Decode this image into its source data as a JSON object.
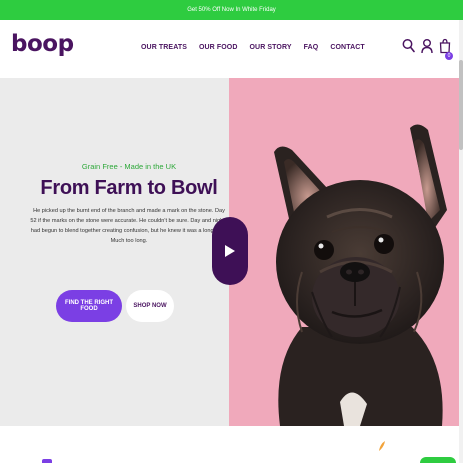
{
  "promo": {
    "text": "Get 50% Off Now In White Friday"
  },
  "brand": {
    "logo": "boop",
    "color": "#4a1460"
  },
  "nav": {
    "items": [
      "OUR TREATS",
      "OUR FOOD",
      "OUR STORY",
      "FAQ",
      "CONTACT"
    ]
  },
  "header_icons": [
    "search-icon",
    "account-icon",
    "cart-icon"
  ],
  "cart": {
    "count": "0"
  },
  "hero": {
    "eyebrow": "Grain Free - Made in the UK",
    "title": "From Farm to Bowl",
    "body": "He picked up the burnt end of the branch and made a mark on the stone. Day 52 if the marks on the stone were accurate. He couldn't be sure. Day and nights had begun to blend together creating confusion, but he knew it was a long time. Much too long.",
    "primary_button": "FIND THE RIGHT FOOD",
    "secondary_button": "SHOP NOW",
    "accent_green": "#2ea83a",
    "accent_purple": "#7b3fe4",
    "pink_background": "#f0a9bb"
  }
}
